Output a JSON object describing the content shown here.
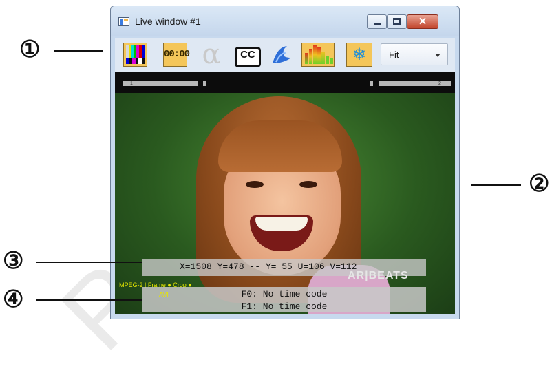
{
  "window": {
    "title": "Live window #1",
    "close_glyph": "✕"
  },
  "toolbar": {
    "clock_label": "00:00",
    "alpha_label": "α",
    "cc_label": "CC",
    "snow_glyph": "❄",
    "fit_select": {
      "selected": "Fit"
    }
  },
  "scrubber": {
    "left_label": "1",
    "right_label": "2"
  },
  "overlay": {
    "coords": "X=1508 Y=478  -- Y= 55 U=106 V=112",
    "watermark": "AR|BEATS",
    "stream_info_line1": "MPEG-2 | Frame ● Crop ●",
    "stream_info_line2": "AVI",
    "timecode_f0": "F0: No time code",
    "timecode_f1": "F1: No time code"
  },
  "callouts": [
    "①",
    "②",
    "③",
    "④"
  ],
  "watermark_text": "Prelim",
  "colors": {
    "accent": "#f4c65a",
    "chrome": "#c7d9ee",
    "close": "#c2452c"
  },
  "icons": [
    "color-bars-icon",
    "timecode-icon",
    "alpha-icon",
    "closed-caption-icon",
    "waveform-icon",
    "audio-level-icon",
    "freeze-icon"
  ]
}
